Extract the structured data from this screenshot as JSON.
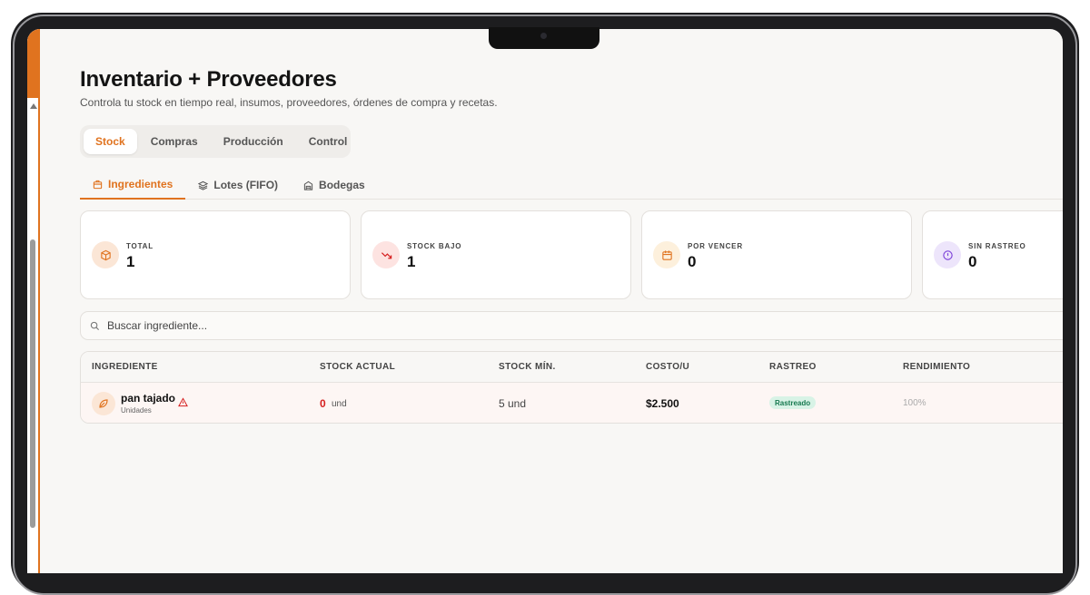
{
  "page": {
    "title": "Inventario + Proveedores",
    "subtitle": "Controla tu stock en tiempo real, insumos, proveedores, órdenes de compra y recetas."
  },
  "main_tabs": [
    {
      "label": "Stock",
      "active": true
    },
    {
      "label": "Compras",
      "active": false
    },
    {
      "label": "Producción",
      "active": false
    },
    {
      "label": "Control",
      "active": false
    }
  ],
  "sub_tabs": [
    {
      "label": "Ingredientes",
      "icon": "box-icon",
      "active": true
    },
    {
      "label": "Lotes (FIFO)",
      "icon": "layers-icon",
      "active": false
    },
    {
      "label": "Bodegas",
      "icon": "warehouse-icon",
      "active": false
    }
  ],
  "cards": [
    {
      "label": "TOTAL",
      "value": "1",
      "icon": "package-icon",
      "color": "#e0731f"
    },
    {
      "label": "STOCK BAJO",
      "value": "1",
      "icon": "trending-down-icon",
      "color": "#d62020"
    },
    {
      "label": "POR VENCER",
      "value": "0",
      "icon": "calendar-icon",
      "color": "#e0731f"
    },
    {
      "label": "SIN RASTREO",
      "value": "0",
      "icon": "alert-circle-icon",
      "color": "#7b3fd8"
    }
  ],
  "search": {
    "placeholder": "Buscar ingrediente..."
  },
  "table": {
    "headers": [
      "INGREDIENTE",
      "STOCK ACTUAL",
      "STOCK MÍN.",
      "COSTO/U",
      "RASTREO",
      "RENDIMIENTO"
    ],
    "rows": [
      {
        "name": "pan tajado",
        "unit_label": "Unidades",
        "stock_actual": "0",
        "stock_unit": "und",
        "stock_min": "5 und",
        "costo": "$2.500",
        "rastreo": "Rastreado",
        "rendimiento": "100%"
      }
    ]
  },
  "colors": {
    "accent": "#e0731f",
    "danger": "#d62020",
    "success_bg": "#d8f3e6",
    "success_text": "#16794f"
  }
}
